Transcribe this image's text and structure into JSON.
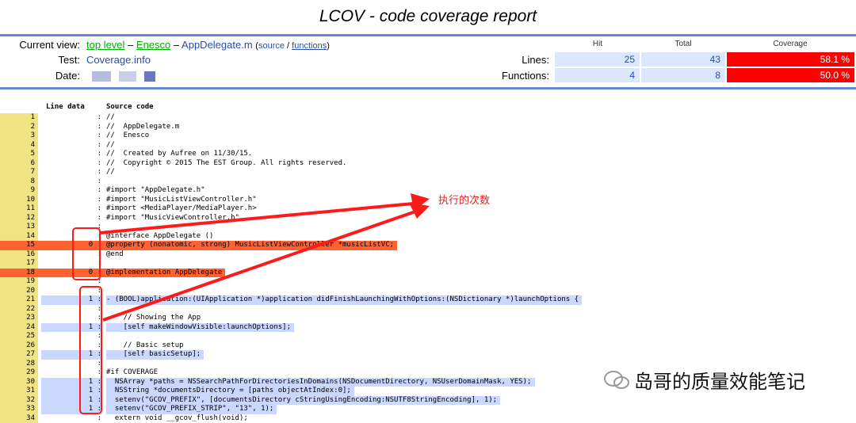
{
  "title": "LCOV - code coverage report",
  "header": {
    "current_view_label": "Current view:",
    "crumb_top": "top level",
    "crumb_sep1": "–",
    "crumb_dir": "Enesco",
    "crumb_sep2": "–",
    "crumb_file": "AppDelegate.m",
    "crumb_open": "(",
    "crumb_source": "source",
    "crumb_slash": " / ",
    "crumb_functions": "functions",
    "crumb_close": ")",
    "test_label": "Test:",
    "test_value": "Coverage.info",
    "date_label": "Date:",
    "col_hit": "Hit",
    "col_total": "Total",
    "col_coverage": "Coverage",
    "lines_label": "Lines:",
    "lines_hit": "25",
    "lines_total": "43",
    "lines_cov": "58.1 %",
    "functions_label": "Functions:",
    "functions_hit": "4",
    "functions_total": "8",
    "functions_cov": "50.0 %"
  },
  "code_header": {
    "line_data": "Line data",
    "source_code": "Source code"
  },
  "lines": [
    {
      "n": "1",
      "c": "",
      "s": "//",
      "t": "none"
    },
    {
      "n": "2",
      "c": "",
      "s": "//  AppDelegate.m",
      "t": "none"
    },
    {
      "n": "3",
      "c": "",
      "s": "//  Enesco",
      "t": "none"
    },
    {
      "n": "4",
      "c": "",
      "s": "//",
      "t": "none"
    },
    {
      "n": "5",
      "c": "",
      "s": "//  Created by Aufree on 11/30/15.",
      "t": "none"
    },
    {
      "n": "6",
      "c": "",
      "s": "//  Copyright © 2015 The EST Group. All rights reserved.",
      "t": "none"
    },
    {
      "n": "7",
      "c": "",
      "s": "//",
      "t": "none"
    },
    {
      "n": "8",
      "c": "",
      "s": "",
      "t": "none"
    },
    {
      "n": "9",
      "c": "",
      "s": "#import \"AppDelegate.h\"",
      "t": "none"
    },
    {
      "n": "10",
      "c": "",
      "s": "#import \"MusicListViewController.h\"",
      "t": "none"
    },
    {
      "n": "11",
      "c": "",
      "s": "#import <MediaPlayer/MediaPlayer.h>",
      "t": "none"
    },
    {
      "n": "12",
      "c": "",
      "s": "#import \"MusicViewController.h\"",
      "t": "none"
    },
    {
      "n": "13",
      "c": "",
      "s": "",
      "t": "none"
    },
    {
      "n": "14",
      "c": "",
      "s": "@interface AppDelegate ()",
      "t": "none"
    },
    {
      "n": "15",
      "c": "0",
      "s": "@property (nonatomic, strong) MusicListViewController *musicListVC;",
      "t": "miss"
    },
    {
      "n": "16",
      "c": "",
      "s": "@end",
      "t": "none"
    },
    {
      "n": "17",
      "c": "",
      "s": "",
      "t": "none"
    },
    {
      "n": "18",
      "c": "0",
      "s": "@implementation AppDelegate",
      "t": "miss"
    },
    {
      "n": "19",
      "c": "",
      "s": "",
      "t": "none"
    },
    {
      "n": "20",
      "c": "",
      "s": "",
      "t": "none"
    },
    {
      "n": "21",
      "c": "1",
      "s": "- (BOOL)application:(UIApplication *)application didFinishLaunchingWithOptions:(NSDictionary *)launchOptions {",
      "t": "hit"
    },
    {
      "n": "22",
      "c": "",
      "s": "",
      "t": "none"
    },
    {
      "n": "23",
      "c": "",
      "s": "    // Showing the App",
      "t": "none"
    },
    {
      "n": "24",
      "c": "1",
      "s": "    [self makeWindowVisible:launchOptions];",
      "t": "hit"
    },
    {
      "n": "25",
      "c": "",
      "s": "",
      "t": "none"
    },
    {
      "n": "26",
      "c": "",
      "s": "    // Basic setup",
      "t": "none"
    },
    {
      "n": "27",
      "c": "1",
      "s": "    [self basicSetup];",
      "t": "hit"
    },
    {
      "n": "28",
      "c": "",
      "s": "",
      "t": "none"
    },
    {
      "n": "29",
      "c": "",
      "s": "#if COVERAGE",
      "t": "none"
    },
    {
      "n": "30",
      "c": "1",
      "s": "  NSArray *paths = NSSearchPathForDirectoriesInDomains(NSDocumentDirectory, NSUserDomainMask, YES);",
      "t": "hit"
    },
    {
      "n": "31",
      "c": "1",
      "s": "  NSString *documentsDirectory = [paths objectAtIndex:0];",
      "t": "hit"
    },
    {
      "n": "32",
      "c": "1",
      "s": "  setenv(\"GCOV_PREFIX\", [documentsDirectory cStringUsingEncoding:NSUTF8StringEncoding], 1);",
      "t": "hit"
    },
    {
      "n": "33",
      "c": "1",
      "s": "  setenv(\"GCOV_PREFIX_STRIP\", \"13\", 1);",
      "t": "hit"
    },
    {
      "n": "34",
      "c": "",
      "s": "  extern void __gcov_flush(void);",
      "t": "none"
    }
  ],
  "annotation": "执行的次数",
  "watermark": "岛哥的质量效能笔记",
  "colors": {
    "rule": "#6688d4",
    "hit_bg": "#cad7fe",
    "miss_bg": "#ff6230",
    "linenum_bg": "#efe383",
    "coverage_low": "#ff0000",
    "annotation": "#e02020"
  }
}
